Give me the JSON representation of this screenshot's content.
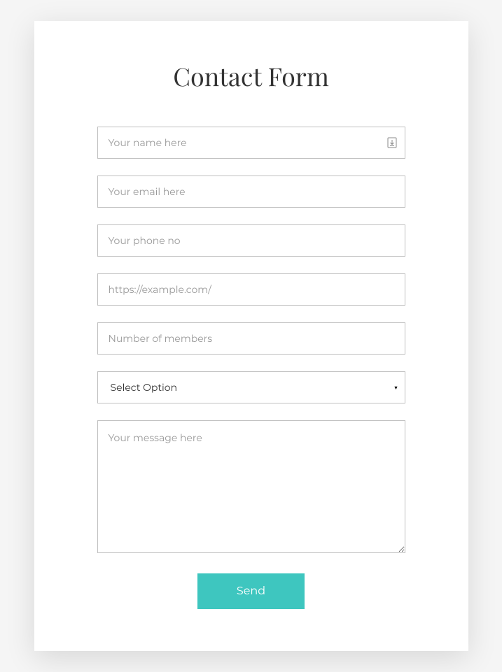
{
  "form": {
    "title": "Contact Form",
    "name": {
      "placeholder": "Your name here",
      "value": ""
    },
    "email": {
      "placeholder": "Your email here",
      "value": ""
    },
    "phone": {
      "placeholder": "Your phone no",
      "value": ""
    },
    "url": {
      "placeholder": "https://example.com/",
      "value": ""
    },
    "members": {
      "placeholder": "Number of members",
      "value": ""
    },
    "select": {
      "selected": "Select Option"
    },
    "message": {
      "placeholder": "Your message here",
      "value": ""
    },
    "submit_label": "Send"
  },
  "colors": {
    "accent": "#3ec6bf",
    "border": "#bfbfbf",
    "placeholder": "#9a9a9a",
    "text": "#333333"
  }
}
